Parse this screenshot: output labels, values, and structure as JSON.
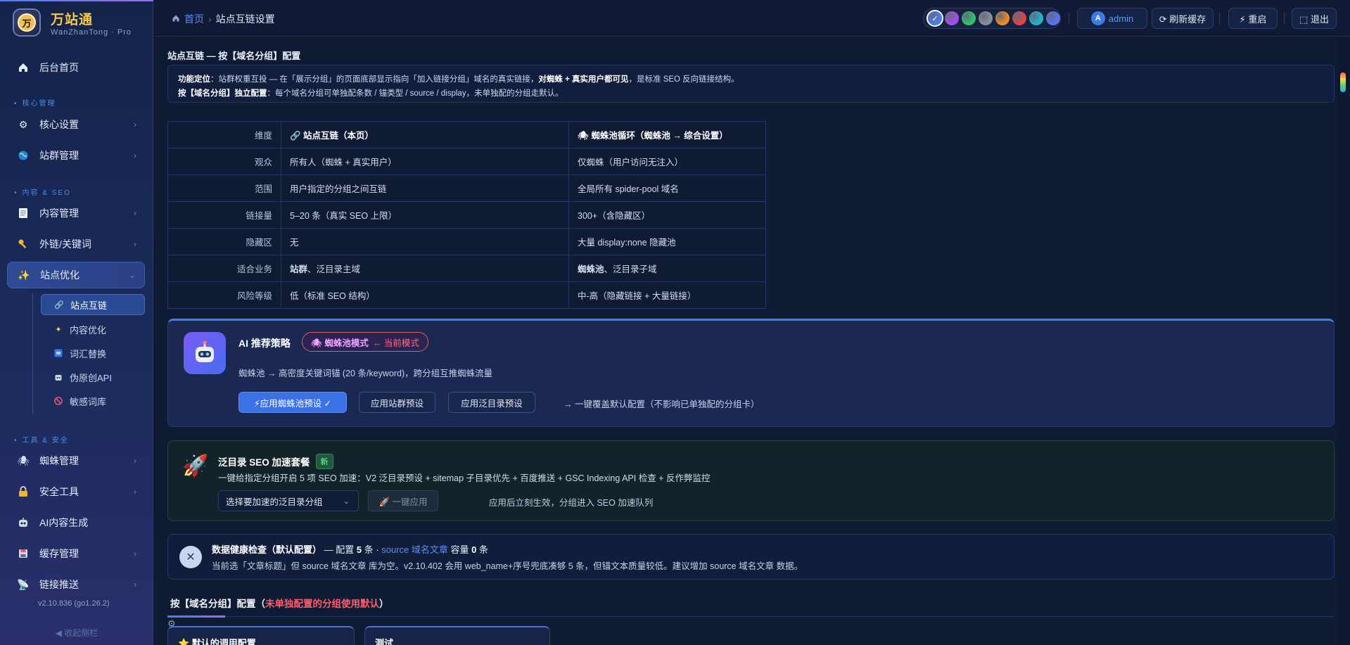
{
  "brand": {
    "name": "万站通",
    "subtitle": "WanZhanTong · Pro",
    "logo_text": "万"
  },
  "sidebar": {
    "top_item": {
      "label": "后台首页",
      "icon": "home-icon"
    },
    "sections": [
      {
        "label": "核心管理",
        "items": [
          {
            "label": "核心设置",
            "icon": "gear-icon"
          },
          {
            "label": "站群管理",
            "icon": "globe-icon"
          }
        ]
      },
      {
        "label": "内容 & SEO",
        "items": [
          {
            "label": "内容管理",
            "icon": "document-icon"
          },
          {
            "label": "外链/关键词",
            "icon": "key-icon"
          },
          {
            "label": "站点优化",
            "icon": "sparkle-icon",
            "expanded": true
          }
        ]
      },
      {
        "label": "工具 & 安全",
        "items": [
          {
            "label": "蜘蛛管理",
            "icon": "spider-icon"
          },
          {
            "label": "安全工具",
            "icon": "lock-icon"
          },
          {
            "label": "AI内容生成",
            "icon": "robot-icon"
          },
          {
            "label": "缓存管理",
            "icon": "save-icon"
          },
          {
            "label": "链接推送",
            "icon": "push-icon"
          }
        ]
      }
    ],
    "sub_items": [
      {
        "label": "站点互链",
        "icon": "link-icon",
        "active": true
      },
      {
        "label": "内容优化",
        "icon": "sparkle-icon"
      },
      {
        "label": "词汇替换",
        "icon": "swap-icon"
      },
      {
        "label": "伪原创API",
        "icon": "robot-icon"
      },
      {
        "label": "敏感词库",
        "icon": "forbidden-icon"
      }
    ],
    "version": "v2.10.836 (go1.26.2)",
    "collapse_label": "◀ 收起侧栏"
  },
  "topbar": {
    "breadcrumb": {
      "home": "首页",
      "sep": "›",
      "current": "站点互链设置"
    },
    "theme_colors": [
      "#4a7cf0",
      "#a64bf0",
      "#2ec26b",
      "#8a8f99",
      "#f08a1e",
      "#e84040",
      "#1fb6c9",
      "#5a72f5"
    ],
    "user": {
      "avatar": "A",
      "name": "admin"
    },
    "refresh_label": "⟳ 刷新缓存",
    "restart_label": "⚡ 重启",
    "logout_label": "⬚ 退出"
  },
  "page": {
    "title": "站点互链 — 按【域名分组】配置",
    "info_line1_lead": "功能定位",
    "info_line1_text": "：站群权重互投 — 在「展示分组」的页面底部显示指向「加入链接分组」域名的真实链接，",
    "info_line1_bold": "对蜘蛛 + 真实用户都可见",
    "info_line1_tail": "，是标准 SEO 反向链接结构。",
    "info_line2_lead": "按【域名分组】独立配置",
    "info_line2_text": "：每个域名分组可单独配条数 / 锚类型 / source / display，未单独配的分组走默认。"
  },
  "compare_table": {
    "headers": [
      "维度",
      "🔗 站点互链（本页）",
      "🕷 蜘蛛池循环（蜘蛛池 → 综合设置）"
    ],
    "rows": [
      [
        "观众",
        "所有人（蜘蛛 + 真实用户）",
        "仅蜘蛛（用户访问无注入）"
      ],
      [
        "范围",
        "用户指定的分组之间互链",
        "全局所有 spider-pool 域名"
      ],
      [
        "链接量",
        "5–20 条（真实 SEO 上限）",
        "300+（含隐藏区）"
      ],
      [
        "隐藏区",
        "无",
        "大量 display:none 隐藏池"
      ],
      [
        "适合业务",
        "站群、泛目录主域",
        "蜘蛛池、泛目录子域"
      ],
      [
        "风险等级",
        "低（标准 SEO 结构）",
        "中-高（隐藏链接 + 大量链接）"
      ]
    ],
    "bold_prefixes": {
      "row5_c1": "站群",
      "row5_c1_rest": "、泛目录主域",
      "row5_c2": "蜘蛛池",
      "row5_c2_rest": "、泛目录子域"
    }
  },
  "ai_strategy": {
    "title": "AI 推荐策略",
    "mode_label": "🕷 蜘蛛池模式",
    "mode_current": "← 当前模式",
    "description": "蜘蛛池 → 高密度关键词锚 (20 条/keyword)，跨分组互推蜘蛛流量",
    "buttons": [
      "⚡应用蜘蛛池预设 ✓",
      "应用站群预设",
      "应用泛目录预设"
    ],
    "note": "→ 一键覆盖默认配置（不影响已单独配的分组卡）"
  },
  "seo_pack": {
    "title": "泛目录 SEO 加速套餐",
    "badge": "新",
    "description": "一键给指定分组开启 5 项 SEO 加速：V2 泛目录预设 + sitemap 子目录优先 + 百度推送 + GSC Indexing API 检查 + 反作弊监控",
    "select_placeholder": "选择要加速的泛目录分组",
    "apply_label": "🚀 一键应用",
    "hint": "应用后立刻生效，分组进入 SEO 加速队列"
  },
  "health": {
    "title": "数据健康检查（默认配置）",
    "mid": " — 配置 ",
    "count1": "5",
    "unit1": " 条 · ",
    "link": "source 域名文章",
    "mid2": " 容量 ",
    "count2": "0",
    "unit2": " 条",
    "detail": "当前选「文章标题」但 source 域名文章 库为空。v2.10.402 会用 web_name+序号兜底凑够 5 条，但锚文本质量较低。建议增加 source 域名文章 数据。"
  },
  "groups": {
    "title": "按【域名分组】配置",
    "title_note_open": "（",
    "title_note": "未单独配置的分组使用默认",
    "title_note_close": "）",
    "cards": [
      "⭐ 默认的调用配置",
      "测试"
    ]
  }
}
